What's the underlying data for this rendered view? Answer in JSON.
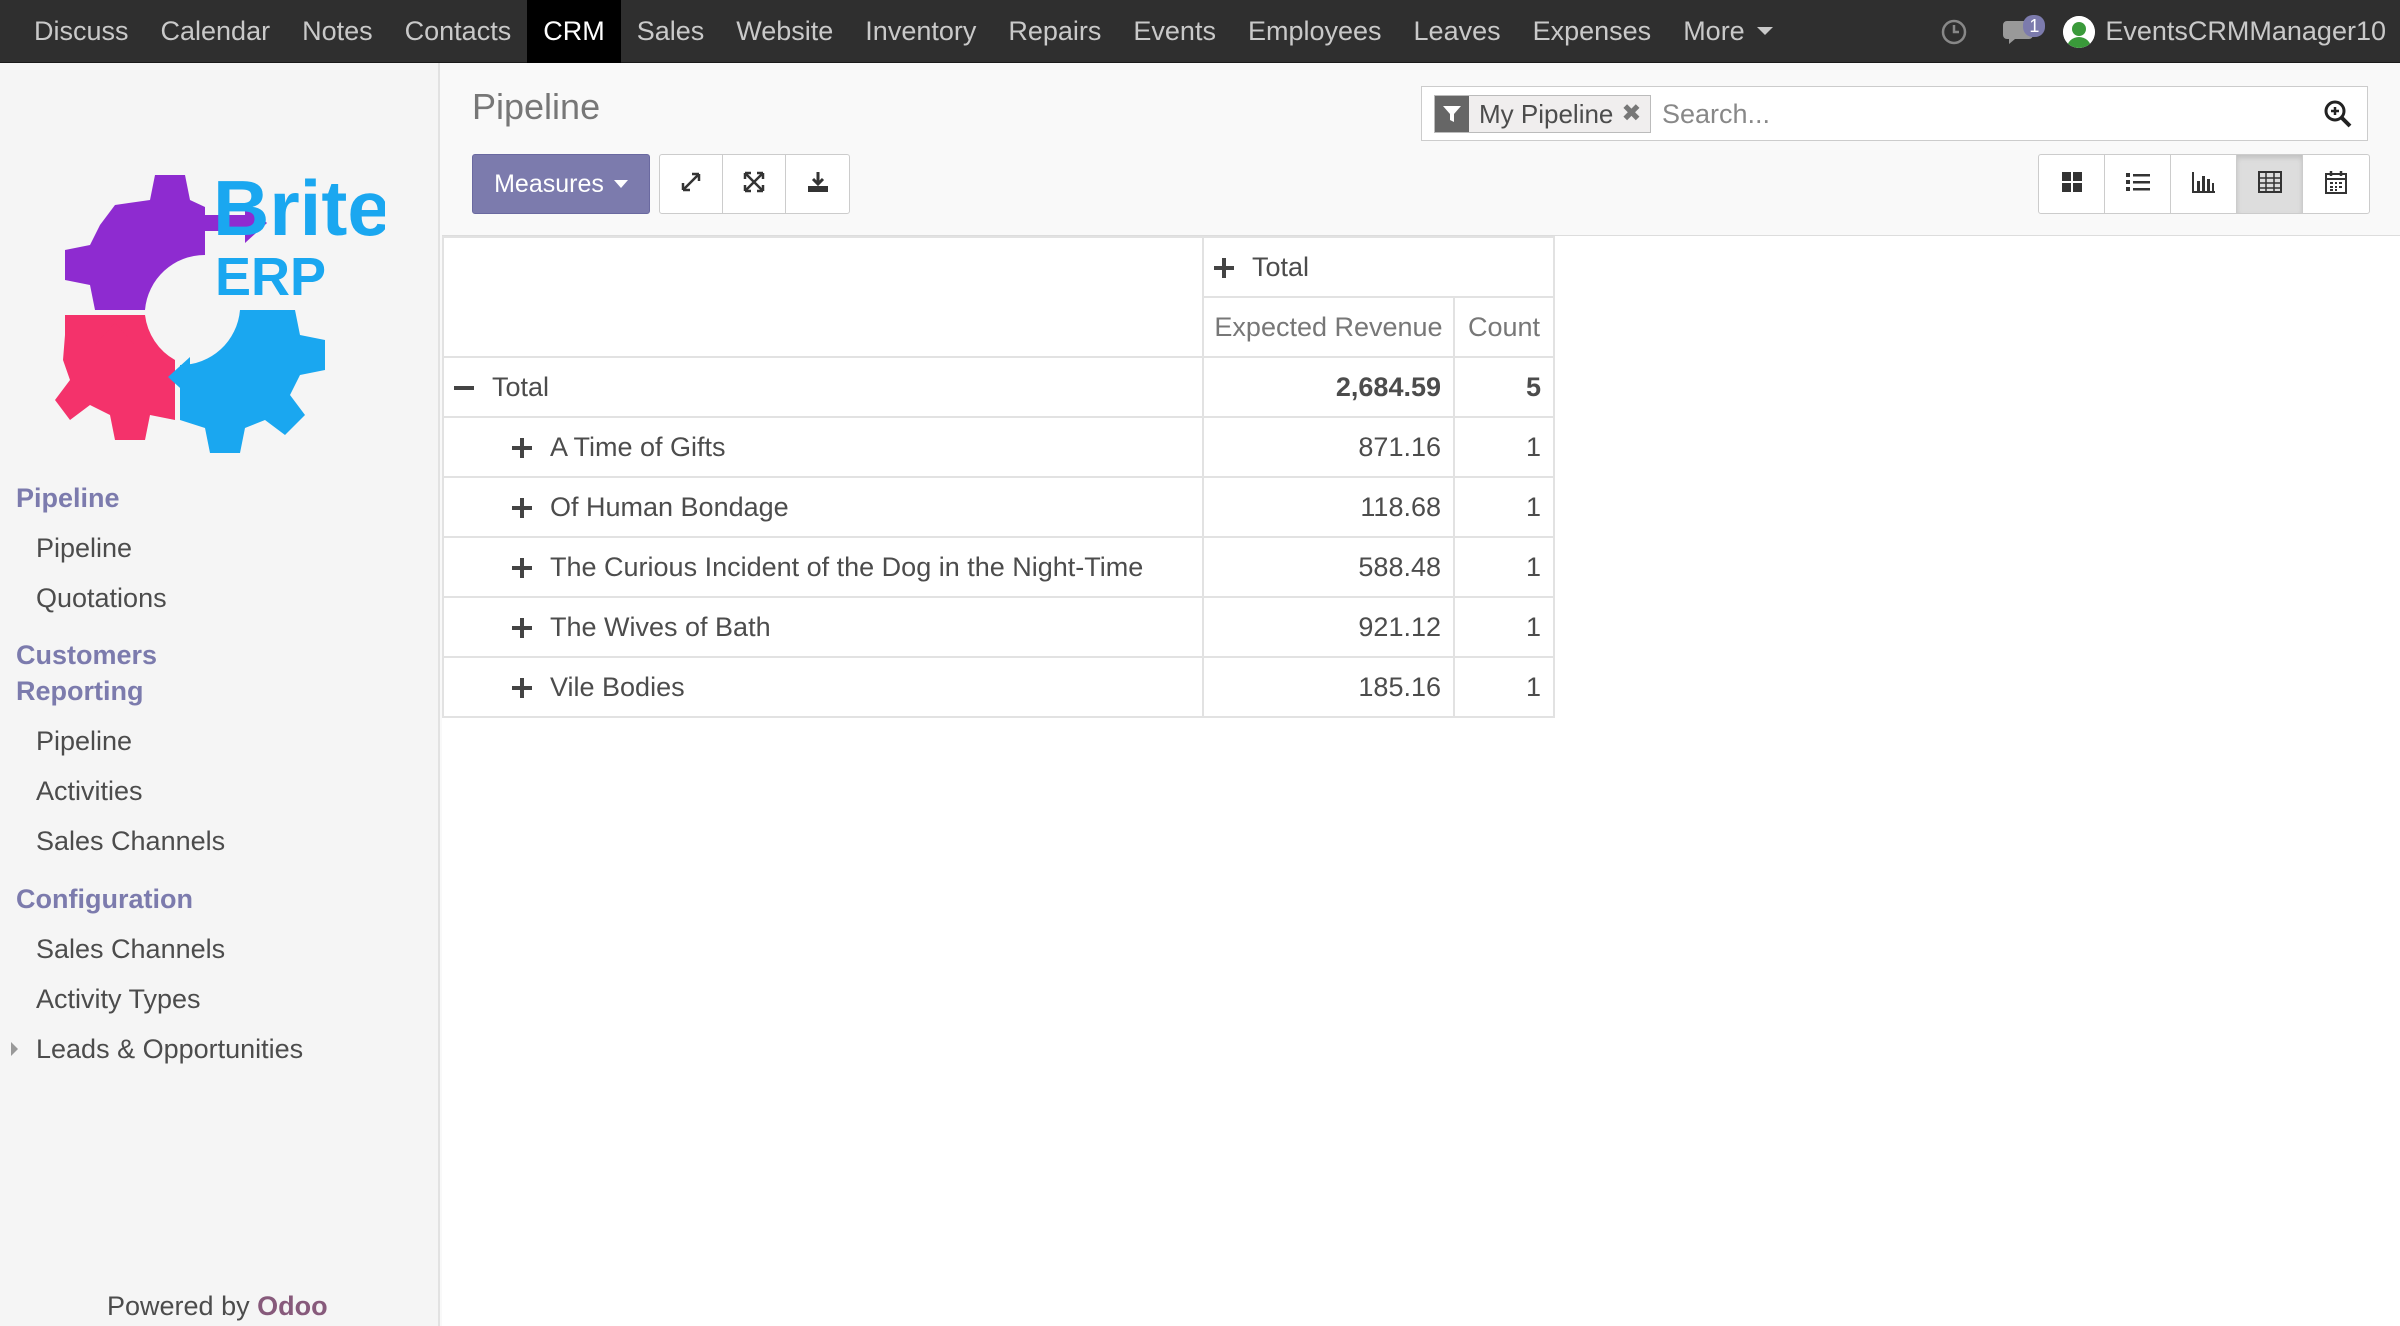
{
  "topbar": {
    "menu": [
      "Discuss",
      "Calendar",
      "Notes",
      "Contacts",
      "CRM",
      "Sales",
      "Website",
      "Inventory",
      "Repairs",
      "Events",
      "Employees",
      "Leaves",
      "Expenses"
    ],
    "more_label": "More",
    "active": "CRM",
    "message_count": "1",
    "user": "EventsCRMManager10"
  },
  "sidebar": {
    "logo_text_1": "Brite",
    "logo_text_2": "ERP",
    "sections": [
      {
        "title": "Pipeline",
        "items": [
          "Pipeline",
          "Quotations"
        ]
      },
      {
        "title": "Customers",
        "items": []
      },
      {
        "title": "Reporting",
        "items": [
          "Pipeline",
          "Activities",
          "Sales Channels"
        ]
      },
      {
        "title": "Configuration",
        "items": [
          "Sales Channels",
          "Activity Types",
          "Leads & Opportunities"
        ]
      }
    ],
    "powered_prefix": "Powered by",
    "powered_brand": "Odoo"
  },
  "control_panel": {
    "breadcrumb": "Pipeline",
    "facet_label": "My Pipeline",
    "search_placeholder": "Search...",
    "measures_label": "Measures"
  },
  "pivot": {
    "col_header": "Total",
    "measures": [
      "Expected Revenue",
      "Count"
    ],
    "total_row": {
      "label": "Total",
      "revenue": "2,684.59",
      "count": "5"
    },
    "rows": [
      {
        "label": "A Time of Gifts",
        "revenue": "871.16",
        "count": "1"
      },
      {
        "label": "Of Human Bondage",
        "revenue": "118.68",
        "count": "1"
      },
      {
        "label": "The Curious Incident of the Dog in the Night-Time",
        "revenue": "588.48",
        "count": "1"
      },
      {
        "label": "The Wives of Bath",
        "revenue": "921.12",
        "count": "1"
      },
      {
        "label": "Vile Bodies",
        "revenue": "185.16",
        "count": "1"
      }
    ]
  },
  "colors": {
    "navbar": "#2f2f2f",
    "accent": "#7c7bad",
    "odoo": "#875a7b",
    "logo_purple": "#8e2bd0",
    "logo_pink": "#f4326b",
    "logo_blue": "#1aa7f0"
  }
}
